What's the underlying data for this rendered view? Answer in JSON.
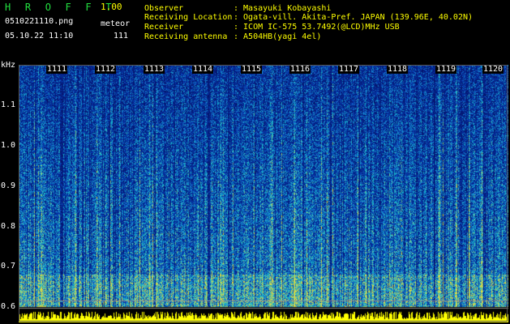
{
  "header": {
    "app_title": "H R O F F T",
    "app_version": "1.00",
    "file_name": "0510221110.png",
    "mode": "meteor",
    "date_time": "05.10.22 11:10",
    "count": "111"
  },
  "info": [
    {
      "label": "Observer",
      "value": ": Masayuki Kobayashi"
    },
    {
      "label": "Receiving Location",
      "value": ": Ogata-vill. Akita-Pref. JAPAN (139.96E, 40.02N)"
    },
    {
      "label": "Receiver",
      "value": ": ICOM IC-575 53.7492(@LCD)MHz USB"
    },
    {
      "label": "Receiving antenna",
      "value": ": A504HB(yagi 4el)"
    }
  ],
  "axis": {
    "unit": "kHz",
    "y_ticks": [
      "1.1",
      "1.0",
      "0.9",
      "0.8",
      "0.7",
      "0.6"
    ],
    "x_ticks": [
      "1111",
      "1112",
      "1113",
      "1114",
      "1115",
      "1116",
      "1117",
      "1118",
      "1119",
      "1120"
    ]
  },
  "colors": {
    "header_green": "#22e040",
    "header_yellow": "#ffff00",
    "signal_baseline": "#ffff00",
    "spectrogram_low": "#08208a",
    "spectrogram_mid": "#1a9ad0",
    "spectrogram_high": "#e8e040"
  }
}
